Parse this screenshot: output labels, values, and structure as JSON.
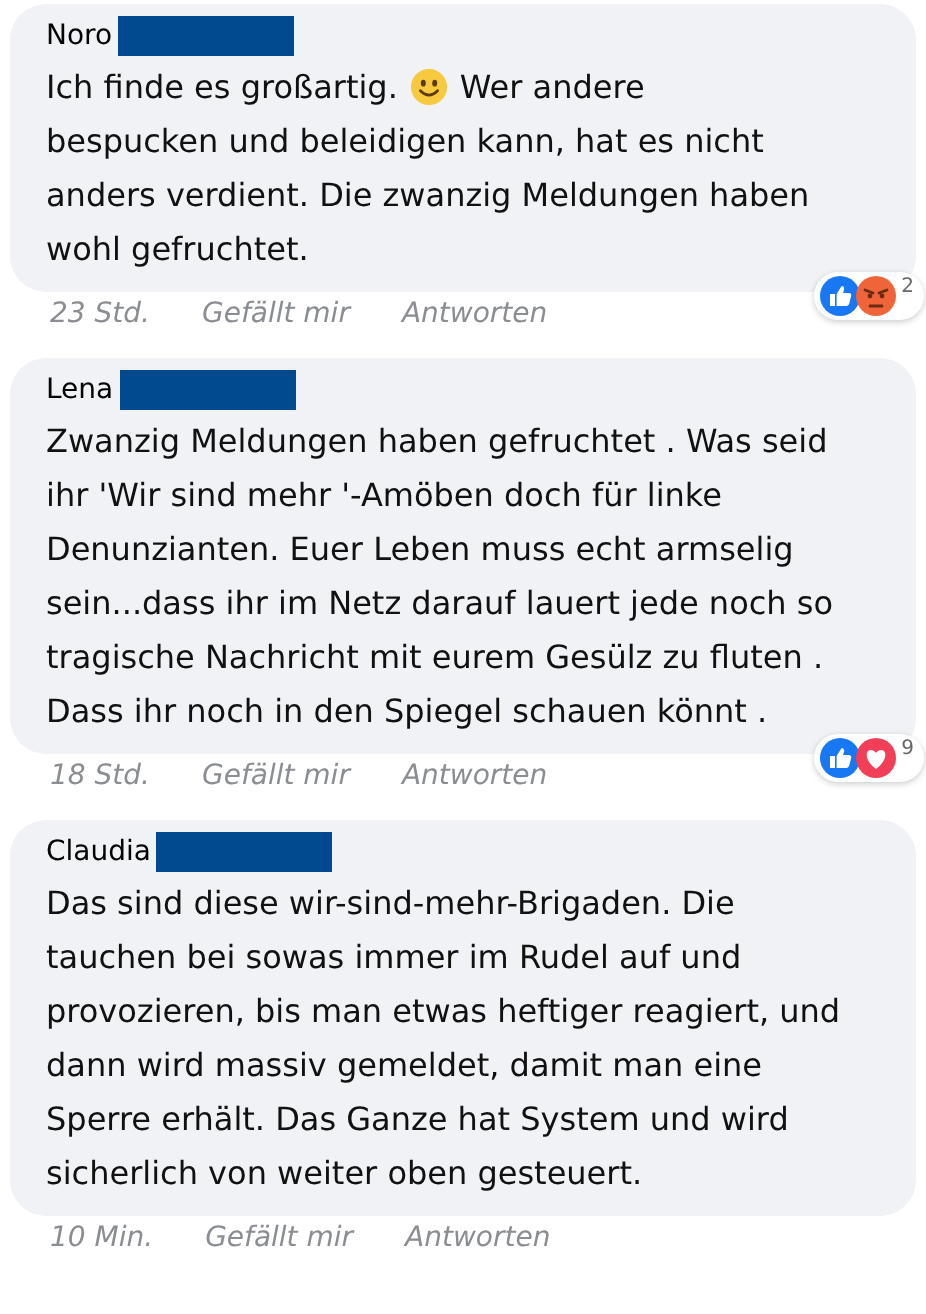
{
  "comments": [
    {
      "author": "Noro",
      "text_lines": [
        [
          {
            "kind": "text",
            "text": "Ich finde es großartig."
          },
          {
            "kind": "emoji"
          },
          {
            "kind": "text",
            "text": "Wer andere"
          }
        ],
        [
          {
            "kind": "text",
            "text": "bespucken und beleidigen kann, hat es nicht anders verdient. Die zwanzig Meldungen haben wohl gefruchtet."
          }
        ]
      ],
      "time": "23 Std.",
      "like_label": "Gefällt mir",
      "reply_label": "Antworten",
      "reactions": {
        "icons": [
          {
            "kind": "like"
          },
          {
            "kind": "angry"
          }
        ],
        "count": "2"
      }
    },
    {
      "author": "Lena",
      "text_lines": [
        [
          {
            "kind": "text",
            "text": "Zwanzig Meldungen haben gefruchtet . Was seid ihr 'Wir sind mehr '-Amöben doch für linke Denunzianten.  Euer Leben muss echt armselig sein...dass ihr im Netz darauf lauert jede noch so tragische Nachricht mit eurem Gesülz zu fluten . Dass ihr noch in den Spiegel schauen könnt ."
          }
        ]
      ],
      "time": "18 Std.",
      "like_label": "Gefällt mir",
      "reply_label": "Antworten",
      "reactions": {
        "icons": [
          {
            "kind": "like"
          },
          {
            "kind": "love"
          }
        ],
        "count": "9"
      }
    },
    {
      "author": "Claudia",
      "text_lines": [
        [
          {
            "kind": "text",
            "text": "Das sind diese wir-sind-mehr-Brigaden. Die tauchen bei sowas immer im Rudel auf und provozieren, bis man etwas heftiger reagiert, und dann wird massiv gemeldet, damit man eine Sperre erhält. Das Ganze hat System und wird sicherlich von weiter oben gesteuert."
          }
        ]
      ],
      "time": "10 Min.",
      "like_label": "Gefällt mir",
      "reply_label": "Antworten"
    }
  ]
}
